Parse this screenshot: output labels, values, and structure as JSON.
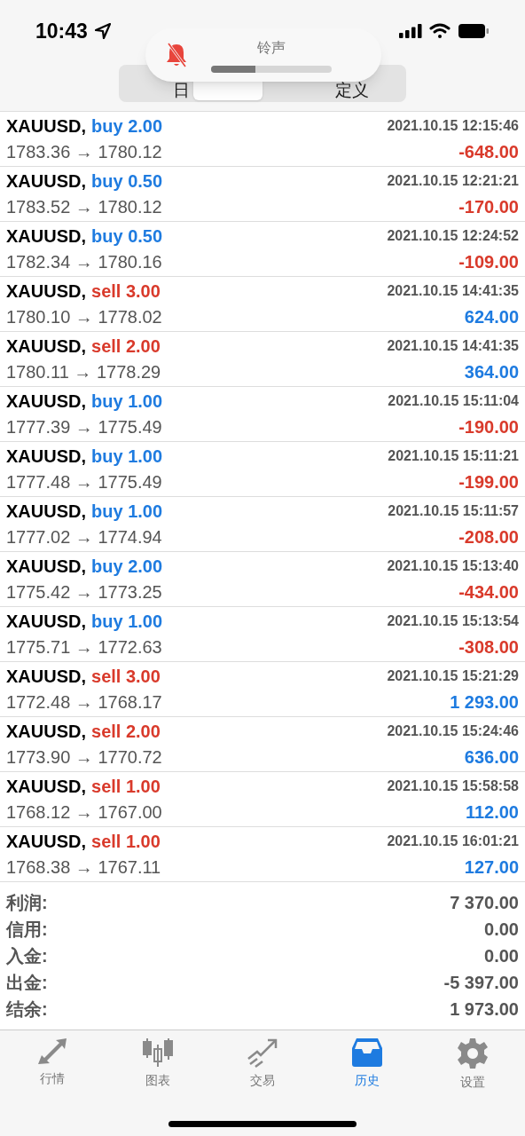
{
  "status_bar": {
    "time": "10:43"
  },
  "segments": [
    {
      "label": "日",
      "selected": false
    },
    {
      "selected": true
    },
    {
      "selected": false
    },
    {
      "label": "定义",
      "selected": false
    }
  ],
  "volume_hud": {
    "title": "铃声",
    "muted": true,
    "level": 0.37
  },
  "trades": [
    {
      "symbol": "XAUUSD,",
      "kind": "buy",
      "action": "buy 2.00",
      "time": "2021.10.15 12:15:46",
      "prices": "1783.36 → 1780.12",
      "profit": "-648.00",
      "gain": false
    },
    {
      "symbol": "XAUUSD,",
      "kind": "buy",
      "action": "buy 0.50",
      "time": "2021.10.15 12:21:21",
      "prices": "1783.52 → 1780.12",
      "profit": "-170.00",
      "gain": false
    },
    {
      "symbol": "XAUUSD,",
      "kind": "buy",
      "action": "buy 0.50",
      "time": "2021.10.15 12:24:52",
      "prices": "1782.34 → 1780.16",
      "profit": "-109.00",
      "gain": false
    },
    {
      "symbol": "XAUUSD,",
      "kind": "sell",
      "action": "sell 3.00",
      "time": "2021.10.15 14:41:35",
      "prices": "1780.10 → 1778.02",
      "profit": "624.00",
      "gain": true
    },
    {
      "symbol": "XAUUSD,",
      "kind": "sell",
      "action": "sell 2.00",
      "time": "2021.10.15 14:41:35",
      "prices": "1780.11 → 1778.29",
      "profit": "364.00",
      "gain": true
    },
    {
      "symbol": "XAUUSD,",
      "kind": "buy",
      "action": "buy 1.00",
      "time": "2021.10.15 15:11:04",
      "prices": "1777.39 → 1775.49",
      "profit": "-190.00",
      "gain": false
    },
    {
      "symbol": "XAUUSD,",
      "kind": "buy",
      "action": "buy 1.00",
      "time": "2021.10.15 15:11:21",
      "prices": "1777.48 → 1775.49",
      "profit": "-199.00",
      "gain": false
    },
    {
      "symbol": "XAUUSD,",
      "kind": "buy",
      "action": "buy 1.00",
      "time": "2021.10.15 15:11:57",
      "prices": "1777.02 → 1774.94",
      "profit": "-208.00",
      "gain": false
    },
    {
      "symbol": "XAUUSD,",
      "kind": "buy",
      "action": "buy 2.00",
      "time": "2021.10.15 15:13:40",
      "prices": "1775.42 → 1773.25",
      "profit": "-434.00",
      "gain": false
    },
    {
      "symbol": "XAUUSD,",
      "kind": "buy",
      "action": "buy 1.00",
      "time": "2021.10.15 15:13:54",
      "prices": "1775.71 → 1772.63",
      "profit": "-308.00",
      "gain": false
    },
    {
      "symbol": "XAUUSD,",
      "kind": "sell",
      "action": "sell 3.00",
      "time": "2021.10.15 15:21:29",
      "prices": "1772.48 → 1768.17",
      "profit": "1 293.00",
      "gain": true
    },
    {
      "symbol": "XAUUSD,",
      "kind": "sell",
      "action": "sell 2.00",
      "time": "2021.10.15 15:24:46",
      "prices": "1773.90 → 1770.72",
      "profit": "636.00",
      "gain": true
    },
    {
      "symbol": "XAUUSD,",
      "kind": "sell",
      "action": "sell 1.00",
      "time": "2021.10.15 15:58:58",
      "prices": "1768.12 → 1767.00",
      "profit": "112.00",
      "gain": true
    },
    {
      "symbol": "XAUUSD,",
      "kind": "sell",
      "action": "sell 1.00",
      "time": "2021.10.15 16:01:21",
      "prices": "1768.38 → 1767.11",
      "profit": "127.00",
      "gain": true
    }
  ],
  "summary": [
    {
      "label": "利润:",
      "value": "7 370.00"
    },
    {
      "label": "信用:",
      "value": "0.00"
    },
    {
      "label": "入金:",
      "value": "0.00"
    },
    {
      "label": "出金:",
      "value": "-5 397.00"
    },
    {
      "label": "结余:",
      "value": "1 973.00"
    }
  ],
  "tab_bar": [
    {
      "kind": "quotes",
      "label": "行情",
      "selected": false
    },
    {
      "kind": "chart",
      "label": "图表",
      "selected": false
    },
    {
      "kind": "trade",
      "label": "交易",
      "selected": false
    },
    {
      "kind": "history",
      "label": "历史",
      "selected": true
    },
    {
      "kind": "settings",
      "label": "设置",
      "selected": false
    }
  ]
}
